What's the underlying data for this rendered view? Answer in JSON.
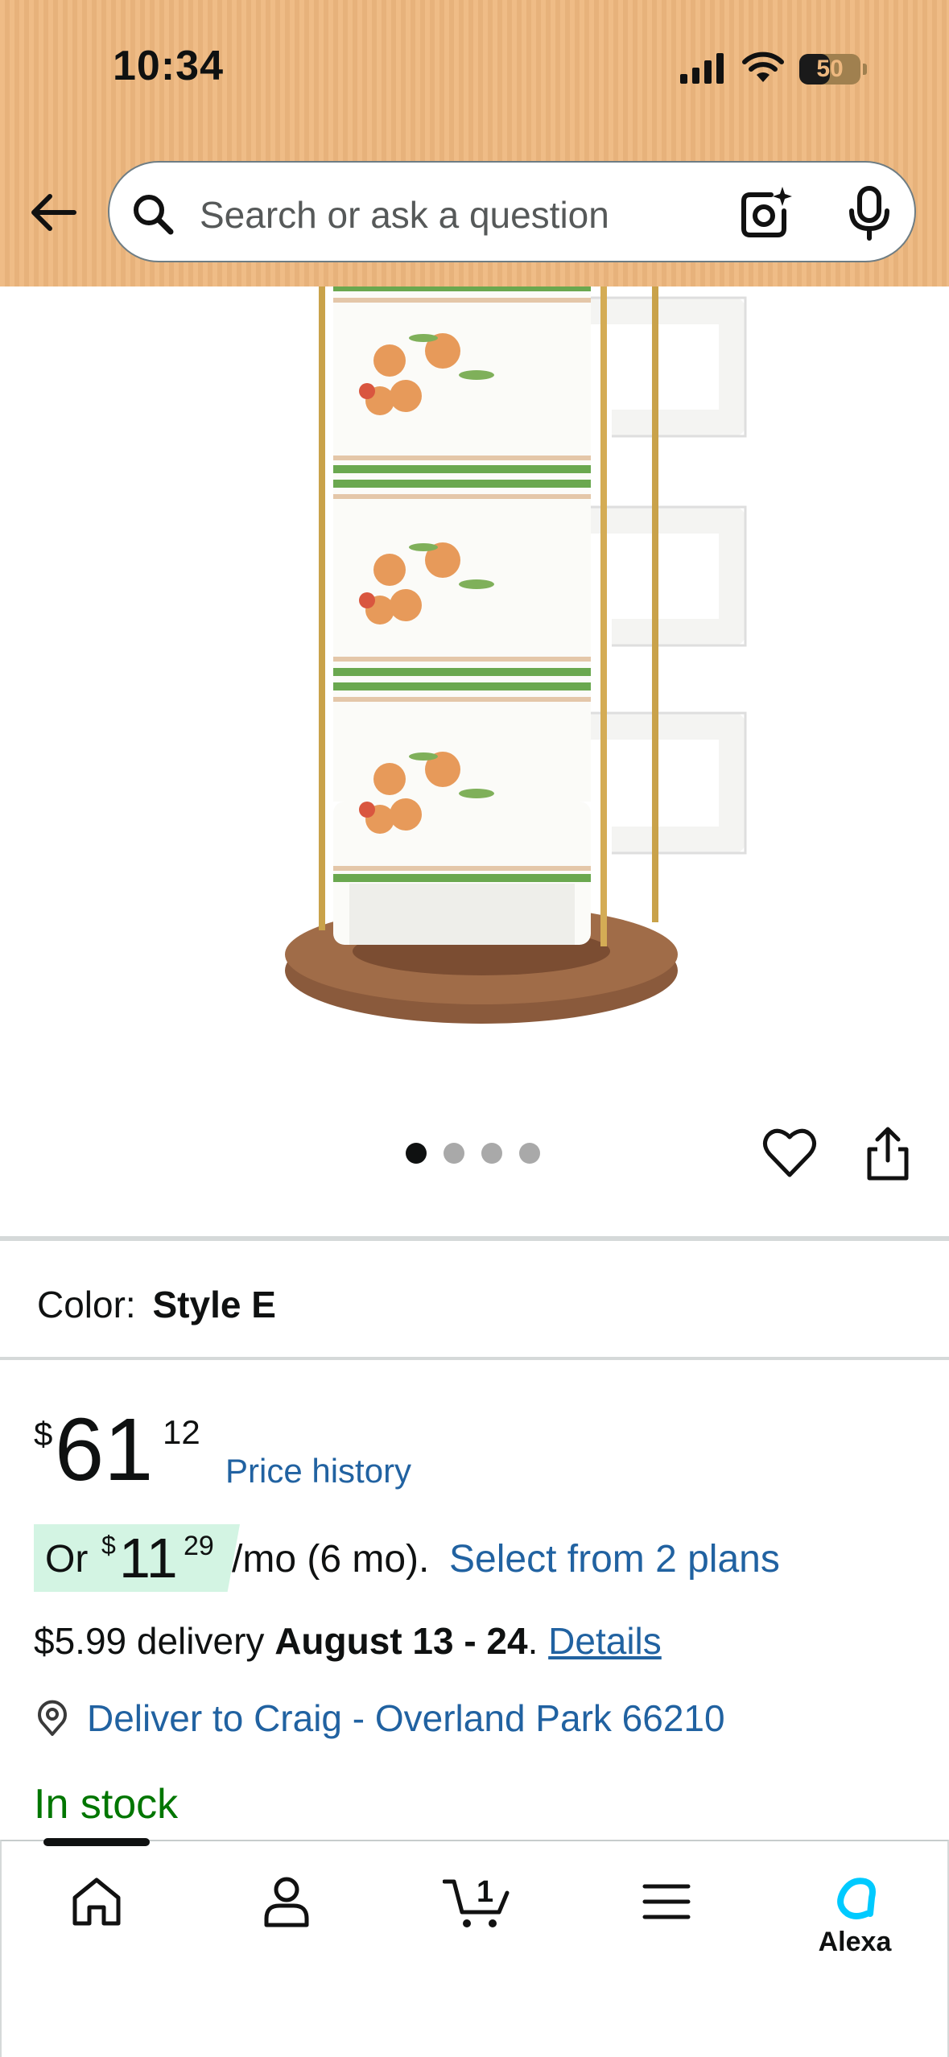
{
  "status_bar": {
    "time": "10:34",
    "battery_level": "50",
    "icons": [
      "signal-icon",
      "wifi-icon",
      "battery-icon"
    ]
  },
  "header": {
    "back_icon": "arrow-left-icon",
    "search_placeholder": "Search or ask a question",
    "search_icon": "search-icon",
    "camera_icon": "camera-sparkle-icon",
    "mic_icon": "microphone-icon"
  },
  "gallery": {
    "image_count": 4,
    "active_index": 0,
    "favorite_icon": "heart-icon",
    "share_icon": "share-icon"
  },
  "variant": {
    "label": "Color:",
    "value": "Style E"
  },
  "price": {
    "currency": "$",
    "whole": "61",
    "fraction": "12",
    "history_link": "Price history"
  },
  "monthly": {
    "prefix": "Or",
    "currency": "$",
    "whole": "11",
    "fraction": "29",
    "term": "/mo (6 mo).",
    "plans_link": "Select from 2 plans"
  },
  "delivery": {
    "fee": "$5.99 delivery",
    "date": "August 13 - 24",
    "separator": ".",
    "details_link": "Details"
  },
  "deliver_to": {
    "icon": "location-pin-icon",
    "text": "Deliver to Craig - Overland Park 66210"
  },
  "stock": "In stock",
  "bottom_nav": {
    "items": [
      {
        "icon": "home-icon",
        "label": ""
      },
      {
        "icon": "account-icon",
        "label": ""
      },
      {
        "icon": "cart-icon",
        "label": "",
        "count": "1"
      },
      {
        "icon": "menu-icon",
        "label": ""
      },
      {
        "icon": "alexa-icon",
        "label": "Alexa"
      }
    ]
  },
  "colors": {
    "header_bg": "#eeb87f",
    "link": "#2162a1",
    "in_stock": "#007600",
    "monthly_badge": "#d3f4e3",
    "alexa": "#00caff"
  }
}
